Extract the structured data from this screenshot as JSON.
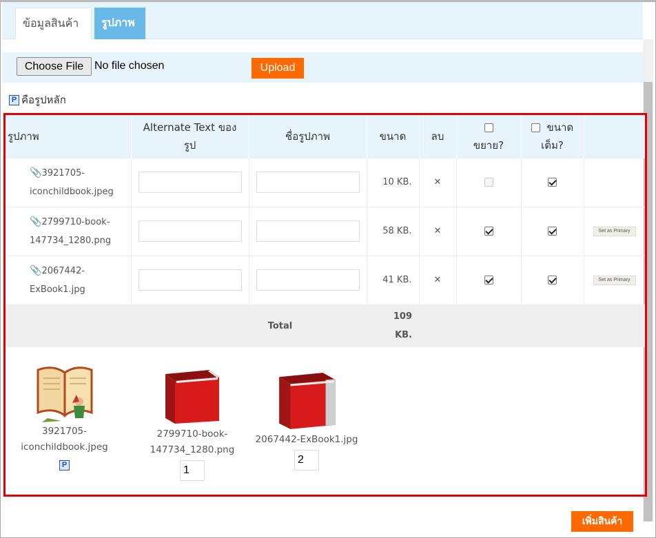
{
  "tabs": {
    "info": "ข้อมูลสินค้า",
    "images": "รูปภาพ"
  },
  "upload": {
    "choose_label": "Choose File",
    "no_file": "No file chosen",
    "upload_label": "Upload"
  },
  "legend": {
    "badge": "P",
    "text": "คือรูปหลัก"
  },
  "table": {
    "headers": {
      "image": "รูปภาพ",
      "alt_line1": "Alternate Text ของ",
      "alt_line2": "รูป",
      "name": "ชื่อรูปภาพ",
      "size": "ขนาด",
      "delete": "ลบ",
      "zoom": "ขยาย?",
      "full_line1": "ขนาด",
      "full_line2": "เต็ม?"
    },
    "rows": [
      {
        "file_line1": "3921705-",
        "file_line2": "iconchildbook.jpeg",
        "size": "10 KB.",
        "delete_icon": "✕",
        "zoom": false,
        "zoom_disabled": true,
        "full": true,
        "set_primary": ""
      },
      {
        "file_line1": "2799710-book-",
        "file_line2": "147734_1280.png",
        "size": "58 KB.",
        "delete_icon": "✕",
        "zoom": true,
        "zoom_disabled": false,
        "full": true,
        "set_primary": "Set as Primary"
      },
      {
        "file_line1": "2067442-",
        "file_line2": "ExBook1.jpg",
        "size": "41 KB.",
        "delete_icon": "✕",
        "zoom": true,
        "zoom_disabled": false,
        "full": true,
        "set_primary": "Set as Primary"
      }
    ],
    "total_label": "Total",
    "total_line1": "109",
    "total_line2": "KB."
  },
  "thumbnails": [
    {
      "caption_line1": "3921705-",
      "caption_line2": "iconchildbook.jpeg",
      "primary_badge": "P",
      "order": ""
    },
    {
      "caption_line1": "2799710-book-",
      "caption_line2": "147734_1280.png",
      "primary_badge": "",
      "order": "1"
    },
    {
      "caption_line1": "2067442-ExBook1.jpg",
      "caption_line2": "",
      "primary_badge": "",
      "order": "2"
    }
  ],
  "footer": {
    "add_product_label": "เพิ่มสินค้า"
  },
  "colors": {
    "accent_orange": "#ff6a00",
    "tab_active": "#69b8ea",
    "header_bg": "#e8f4fc",
    "highlight_border": "#e00000",
    "delete_red": "#e03a3a"
  }
}
